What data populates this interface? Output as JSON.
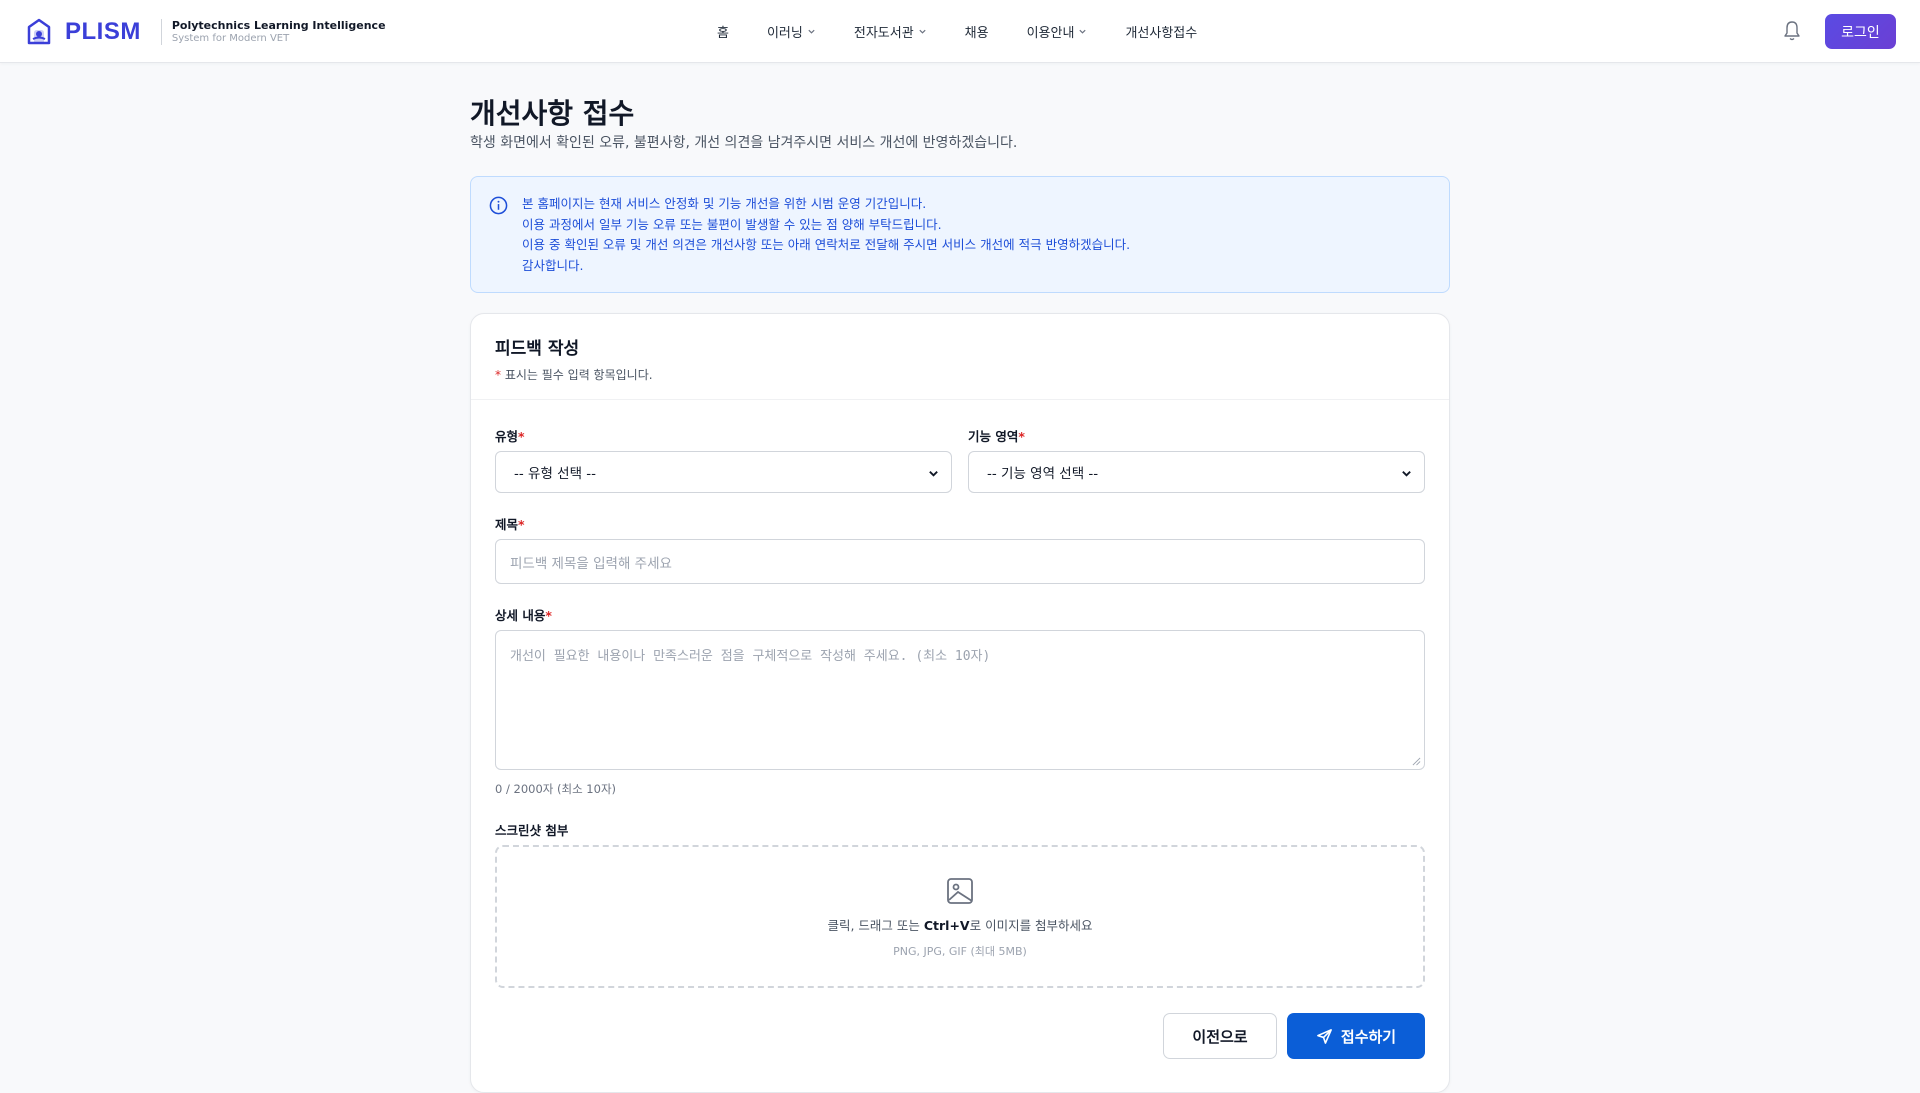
{
  "brand": {
    "name": "PLISM",
    "tagline_line1": "Polytechnics Learning Intelligence",
    "tagline_line2": "System for Modern VET",
    "logo_icon": "building-hand-icon",
    "brand_color": "#3b3fd8"
  },
  "nav": {
    "items": [
      {
        "label": "홈",
        "has_dropdown": false
      },
      {
        "label": "이러닝",
        "has_dropdown": true
      },
      {
        "label": "전자도서관",
        "has_dropdown": true
      },
      {
        "label": "채용",
        "has_dropdown": false
      },
      {
        "label": "이용안내",
        "has_dropdown": true
      },
      {
        "label": "개선사항접수",
        "has_dropdown": false
      }
    ]
  },
  "header": {
    "bell_icon": "bell-icon",
    "login_label": "로그인",
    "login_color": "#5a4be3"
  },
  "page": {
    "title": "개선사항 접수",
    "description": "학생 화면에서 확인된 오류, 불편사항, 개선 의견을 남겨주시면 서비스 개선에 반영하겠습니다."
  },
  "notice": {
    "icon": "info-circle-icon",
    "lines": [
      "본 홈페이지는 현재 서비스 안정화 및 기능 개선을 위한 시범 운영 기간입니다.",
      "이용 과정에서 일부 기능 오류 또는 불편이 발생할 수 있는 점 양해 부탁드립니다.",
      "이용 중 확인된 오류 및 개선 의견은 개선사항 또는 아래 연락처로 전달해 주시면 서비스 개선에 적극 반영하겠습니다.",
      "감사합니다."
    ],
    "accent_color": "#1d4ed8"
  },
  "form": {
    "title": "피드백 작성",
    "required_mark": "*",
    "required_note": "표시는 필수 입력 항목입니다.",
    "type": {
      "label": "유형",
      "value": "-- 유형 선택 --"
    },
    "area": {
      "label": "기능 영역",
      "value": "-- 기능 영역 선택 --"
    },
    "subject": {
      "label": "제목",
      "placeholder": "피드백 제목을 입력해 주세요"
    },
    "detail": {
      "label": "상세 내용",
      "placeholder": "개선이 필요한 내용이나 만족스러운 점을 구체적으로 작성해 주세요. (최소 10자)",
      "counter": "0 / 2000자 (최소 10자)"
    },
    "attachment": {
      "label": "스크린샷 첨부",
      "icon": "image-icon",
      "text_before": "클릭, 드래그 또는 ",
      "text_bold": "Ctrl+V",
      "text_after": "로 이미지를 첨부하세요",
      "hint": "PNG, JPG, GIF (최대 5MB)"
    },
    "prev_label": "이전으로",
    "submit_label": "접수하기",
    "submit_icon": "send-icon",
    "submit_color": "#0b5ed7"
  }
}
